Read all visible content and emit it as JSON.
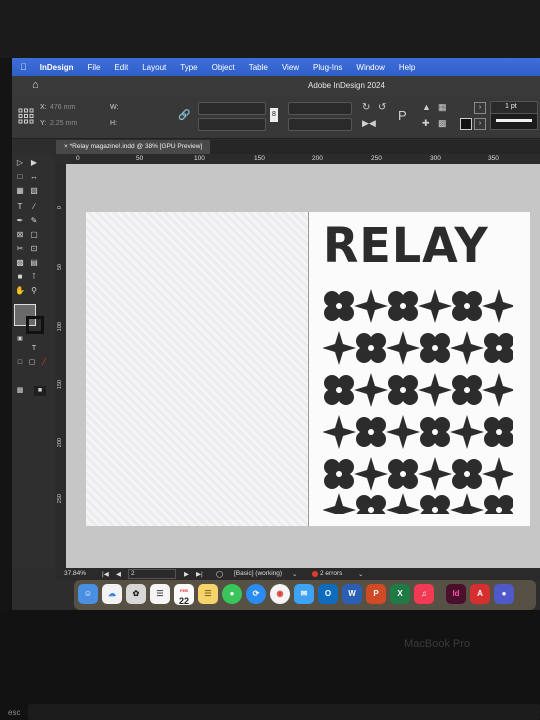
{
  "menubar": {
    "app_name": "InDesign",
    "items": [
      "File",
      "Edit",
      "Layout",
      "Type",
      "Object",
      "Table",
      "View",
      "Plug-Ins",
      "Window",
      "Help"
    ]
  },
  "window": {
    "title": "Adobe InDesign 2024"
  },
  "control_panel": {
    "x_label": "X:",
    "x_value": "476 mm",
    "y_label": "Y:",
    "y_value": "2.25 mm",
    "w_label": "W:",
    "h_label": "H:",
    "stroke_weight": "1 pt"
  },
  "document_tab": {
    "label": "*Relay magazine!.indd @ 38% [GPU Preview]"
  },
  "ruler_h_ticks": [
    "0",
    "50",
    "100",
    "150",
    "200",
    "250",
    "300",
    "350"
  ],
  "ruler_v_ticks": [
    "0",
    "50",
    "100",
    "150",
    "200",
    "250"
  ],
  "artwork": {
    "headline": "RELAY"
  },
  "statusbar": {
    "zoom": "37.84%",
    "page": "2",
    "preflight_profile": "[Basic] (working)",
    "errors": "2 errors"
  },
  "dock": {
    "calendar_month": "FEB",
    "calendar_day": "22",
    "icons": [
      "finder-icon",
      "icloud-icon",
      "chatgpt-icon",
      "reminders-icon",
      "calendar-icon",
      "notes-icon",
      "messages-icon",
      "safari-icon",
      "chrome-icon",
      "mail-icon",
      "outlook-icon",
      "word-icon",
      "powerpoint-icon",
      "excel-icon",
      "music-icon",
      "indesign-icon",
      "acrobat-icon",
      "teams-icon"
    ],
    "labels": {
      "word": "W",
      "powerpoint": "P",
      "excel": "X",
      "outlook": "O",
      "indesign": "Id",
      "acrobat": "A"
    }
  },
  "laptop": {
    "brand": "MacBook Pro",
    "esc_key": "esc"
  },
  "colors": {
    "menubar": "#2f5fc8",
    "error": "#e23b2e",
    "ink": "#2c2c2c"
  }
}
